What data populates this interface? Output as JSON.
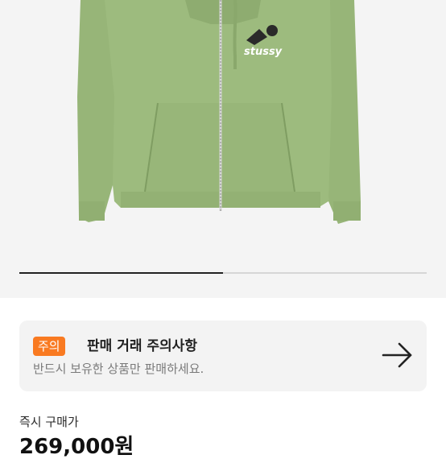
{
  "product": {
    "image_desc_icon": "hoodie-image",
    "logo_text": "stussy",
    "hoodie_color": "#9cba7c",
    "slider_progress": 0.5
  },
  "notice": {
    "badge": "주의",
    "title": "판매 거래 주의사항",
    "description": "반드시 보유한 상품만 판매하세요.",
    "arrow_icon": "arrow-right-icon",
    "badge_color": "#f97a21"
  },
  "price": {
    "label": "즉시 구매가",
    "value": "269,000원"
  }
}
